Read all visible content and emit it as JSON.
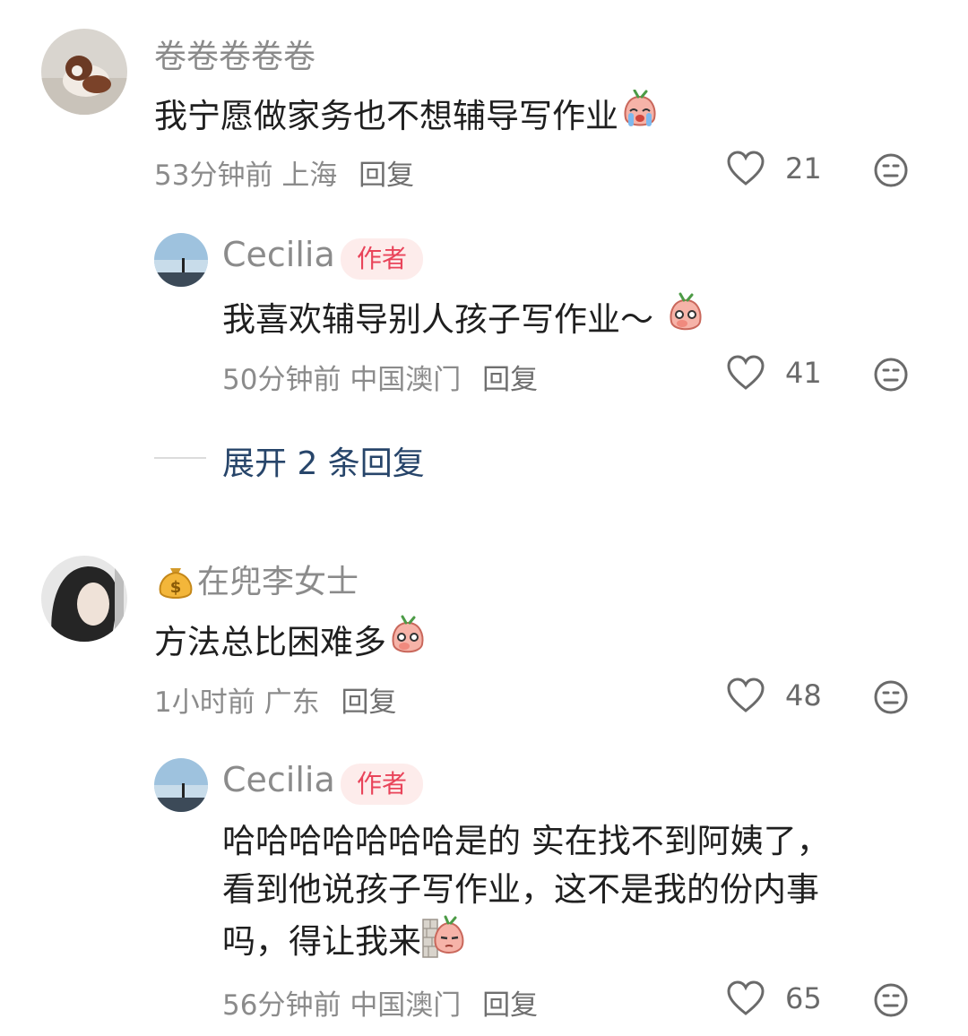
{
  "comments": [
    {
      "user": "卷卷卷卷卷",
      "text": "我宁愿做家务也不想辅导写作业",
      "time": "53分钟前",
      "location": "上海",
      "reply_label": "回复",
      "likes": "21",
      "emoji": "crying-radish",
      "replies": [
        {
          "user": "Cecilia",
          "badge": "作者",
          "text": "我喜欢辅导别人孩子写作业～",
          "time": "50分钟前",
          "location": "中国澳门",
          "reply_label": "回复",
          "likes": "41",
          "emoji": "shy-radish"
        }
      ],
      "expand_label": "展开 2 条回复"
    },
    {
      "user_prefix_icon": "money-bag-icon",
      "user": "在兜李女士",
      "text": "方法总比困难多",
      "time": "1小时前",
      "location": "广东",
      "reply_label": "回复",
      "likes": "48",
      "emoji": "shy-radish",
      "replies": [
        {
          "user": "Cecilia",
          "badge": "作者",
          "text_lines": [
            "哈哈哈哈哈哈哈是的 实在找不到阿姨了，",
            "看到他说孩子写作业，这不是我的份内事",
            "吗，得让我来"
          ],
          "time": "56分钟前",
          "location": "中国澳门",
          "reply_label": "回复",
          "likes": "65",
          "emoji": "peeking-radish"
        }
      ]
    }
  ]
}
